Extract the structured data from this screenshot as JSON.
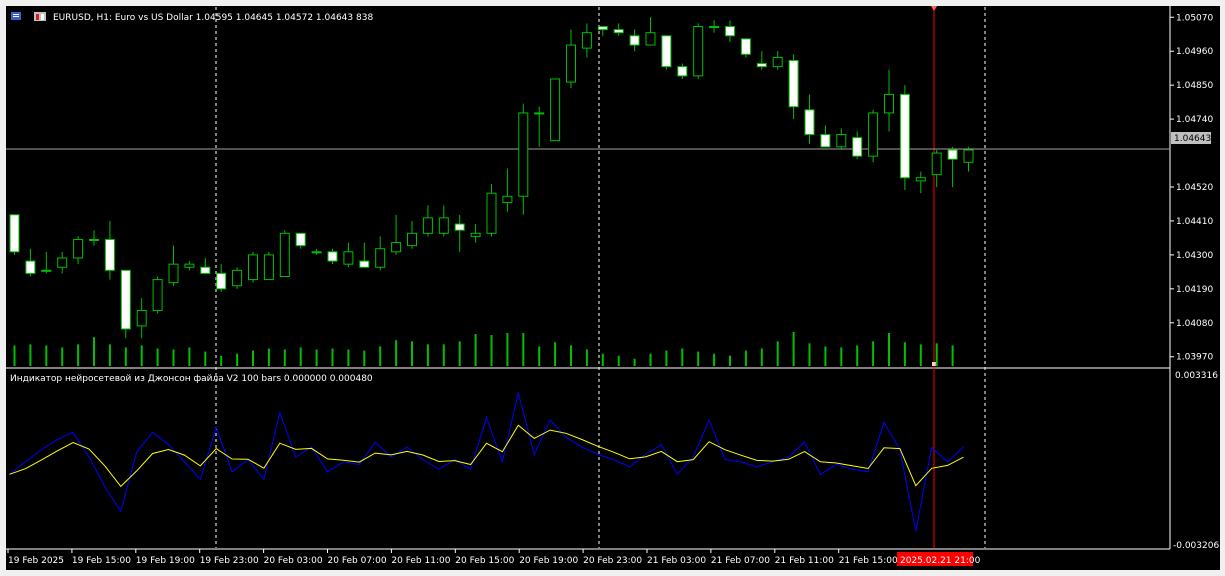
{
  "main_chart": {
    "symbol_info": "EURUSD, H1:  Euro vs US Dollar  1.04595 1.04645 1.04572 1.04643  838",
    "price_ticks": [
      "1.05070",
      "1.04960",
      "1.04850",
      "1.04740",
      "1.04520",
      "1.04410",
      "1.04300",
      "1.04190",
      "1.04080",
      "1.03970"
    ],
    "current_price_label": "1.04643",
    "current_price": 1.04643,
    "price_range": [
      1.0394,
      1.051
    ],
    "colors": {
      "bull": "#00c000",
      "bear_body": "#ffffff",
      "volume": "#00c000",
      "background": "#000000",
      "price_line": "#a0a0a0",
      "now_line": "#ff0000"
    }
  },
  "indicator": {
    "title": "Индикатор нейросетевой из Джонсон файла V2 100 bars 0.000000 0.000480",
    "top_label": "0.003316",
    "bottom_label": "-0.003206",
    "colors": {
      "line1": "#0000ff",
      "line2": "#ffff00"
    }
  },
  "time_axis": {
    "labels": [
      "19 Feb 2025",
      "19 Feb 15:00",
      "19 Feb 19:00",
      "19 Feb 23:00",
      "20 Feb 03:00",
      "20 Feb 07:00",
      "20 Feb 11:00",
      "20 Feb 15:00",
      "20 Feb 19:00",
      "20 Feb 23:00",
      "21 Feb 03:00",
      "21 Feb 07:00",
      "21 Feb 11:00",
      "21 Feb 15:00"
    ],
    "highlight_label": "2025.02.21 21:00"
  },
  "chart_data": {
    "type": "candlestick",
    "ohlc": [
      [
        1.0443,
        1.0443,
        1.043,
        1.0431
      ],
      [
        1.0428,
        1.0432,
        1.0423,
        1.0424
      ],
      [
        1.0425,
        1.0431,
        1.0424,
        1.0425
      ],
      [
        1.0426,
        1.0431,
        1.0424,
        1.0429
      ],
      [
        1.0429,
        1.0436,
        1.0427,
        1.0435
      ],
      [
        1.0435,
        1.0438,
        1.0433,
        1.0435
      ],
      [
        1.0435,
        1.0441,
        1.0422,
        1.0425
      ],
      [
        1.0425,
        1.0425,
        1.0403,
        1.0406
      ],
      [
        1.0407,
        1.0416,
        1.0403,
        1.0412
      ],
      [
        1.0412,
        1.0423,
        1.0411,
        1.0422
      ],
      [
        1.0421,
        1.0433,
        1.042,
        1.0427
      ],
      [
        1.0426,
        1.0428,
        1.0425,
        1.0427
      ],
      [
        1.0426,
        1.0429,
        1.0424,
        1.0424
      ],
      [
        1.0424,
        1.0427,
        1.0418,
        1.0419
      ],
      [
        1.042,
        1.0426,
        1.0419,
        1.0425
      ],
      [
        1.0422,
        1.0431,
        1.0421,
        1.043
      ],
      [
        1.0422,
        1.0431,
        1.0422,
        1.043
      ],
      [
        1.0423,
        1.0438,
        1.0423,
        1.0437
      ],
      [
        1.0437,
        1.0437,
        1.0432,
        1.0433
      ],
      [
        1.0431,
        1.0432,
        1.043,
        1.0431
      ],
      [
        1.0431,
        1.0432,
        1.0427,
        1.0428
      ],
      [
        1.0427,
        1.0434,
        1.0426,
        1.0431
      ],
      [
        1.0428,
        1.0434,
        1.0427,
        1.0426
      ],
      [
        1.0426,
        1.0436,
        1.0425,
        1.0432
      ],
      [
        1.0431,
        1.0443,
        1.043,
        1.0434
      ],
      [
        1.0433,
        1.0441,
        1.0432,
        1.0437
      ],
      [
        1.0437,
        1.0446,
        1.0436,
        1.0442
      ],
      [
        1.0437,
        1.0446,
        1.0436,
        1.0442
      ],
      [
        1.044,
        1.0443,
        1.0431,
        1.0438
      ],
      [
        1.0436,
        1.044,
        1.0434,
        1.0437
      ],
      [
        1.0437,
        1.0453,
        1.0436,
        1.045
      ],
      [
        1.0447,
        1.0458,
        1.0444,
        1.0449
      ],
      [
        1.0449,
        1.0479,
        1.0443,
        1.0476
      ],
      [
        1.0476,
        1.0478,
        1.0465,
        1.0476
      ],
      [
        1.0467,
        1.0485,
        1.0467,
        1.0487
      ],
      [
        1.0486,
        1.0503,
        1.0484,
        1.0498
      ],
      [
        1.0497,
        1.0505,
        1.0494,
        1.0502
      ],
      [
        1.0504,
        1.0504,
        1.0501,
        1.0503
      ],
      [
        1.0503,
        1.0505,
        1.0501,
        1.0502
      ],
      [
        1.0501,
        1.0503,
        1.0496,
        1.0498
      ],
      [
        1.0498,
        1.0507,
        1.0498,
        1.0502
      ],
      [
        1.0501,
        1.0501,
        1.049,
        1.0491
      ],
      [
        1.0491,
        1.0492,
        1.0487,
        1.0488
      ],
      [
        1.0488,
        1.0505,
        1.0487,
        1.0504
      ],
      [
        1.0504,
        1.0506,
        1.0502,
        1.0504
      ],
      [
        1.0504,
        1.0506,
        1.0499,
        1.0501
      ],
      [
        1.05,
        1.05,
        1.0494,
        1.0495
      ],
      [
        1.0492,
        1.0496,
        1.049,
        1.0491
      ],
      [
        1.0491,
        1.0496,
        1.049,
        1.0494
      ],
      [
        1.0493,
        1.0495,
        1.0474,
        1.0478
      ],
      [
        1.0477,
        1.0482,
        1.0466,
        1.0469
      ],
      [
        1.0469,
        1.0472,
        1.0468,
        1.0465
      ],
      [
        1.0465,
        1.0471,
        1.0464,
        1.0469
      ],
      [
        1.0468,
        1.047,
        1.0461,
        1.0462
      ],
      [
        1.0462,
        1.0477,
        1.046,
        1.0476
      ],
      [
        1.0476,
        1.049,
        1.047,
        1.0482
      ],
      [
        1.0482,
        1.0485,
        1.0451,
        1.0455
      ],
      [
        1.0454,
        1.0457,
        1.045,
        1.0455
      ],
      [
        1.0456,
        1.0464,
        1.0452,
        1.0463
      ],
      [
        1.0464,
        1.0465,
        1.0452,
        1.0461
      ],
      [
        1.046,
        1.0465,
        1.0457,
        1.0464
      ]
    ],
    "volume": [
      20,
      21,
      20,
      18,
      21,
      28,
      21,
      18,
      20,
      17,
      16,
      18,
      14,
      10,
      12,
      15,
      17,
      16,
      18,
      16,
      17,
      16,
      15,
      19,
      25,
      24,
      21,
      21,
      24,
      31,
      30,
      32,
      32,
      19,
      23,
      20,
      16,
      12,
      10,
      7,
      12,
      15,
      17,
      14,
      12,
      10,
      15,
      17,
      24,
      33,
      22,
      19,
      18,
      20,
      24,
      32,
      23,
      21,
      22,
      20
    ],
    "indicator_line1": [
      -0.0003,
      0.0002,
      0.0007,
      0.0011,
      0.0014,
      0.0004,
      -0.0008,
      -0.0018,
      0.0006,
      0.0014,
      0.0009,
      0.0002,
      -0.0005,
      0.0016,
      -0.0002,
      0.0003,
      -0.0005,
      0.0022,
      0.0004,
      0.0008,
      -0.0002,
      0.0002,
      0.0001,
      0.001,
      0.0004,
      0.0008,
      0.0003,
      -0.0001,
      0.0003,
      -0.0001,
      0.002,
      0.0002,
      0.003,
      0.0005,
      0.0019,
      0.0012,
      0.0008,
      0.0005,
      0.0003,
      0.0,
      0.0005,
      0.0009,
      -0.0003,
      0.0004,
      0.0019,
      0.0003,
      0.0002,
      0.0,
      0.0002,
      0.0004,
      0.001,
      -0.0003,
      0.0001,
      -0.0001,
      -0.0002,
      0.0018,
      0.0007,
      -0.0026,
      0.0008,
      0.0002,
      0.0008
    ]
  }
}
